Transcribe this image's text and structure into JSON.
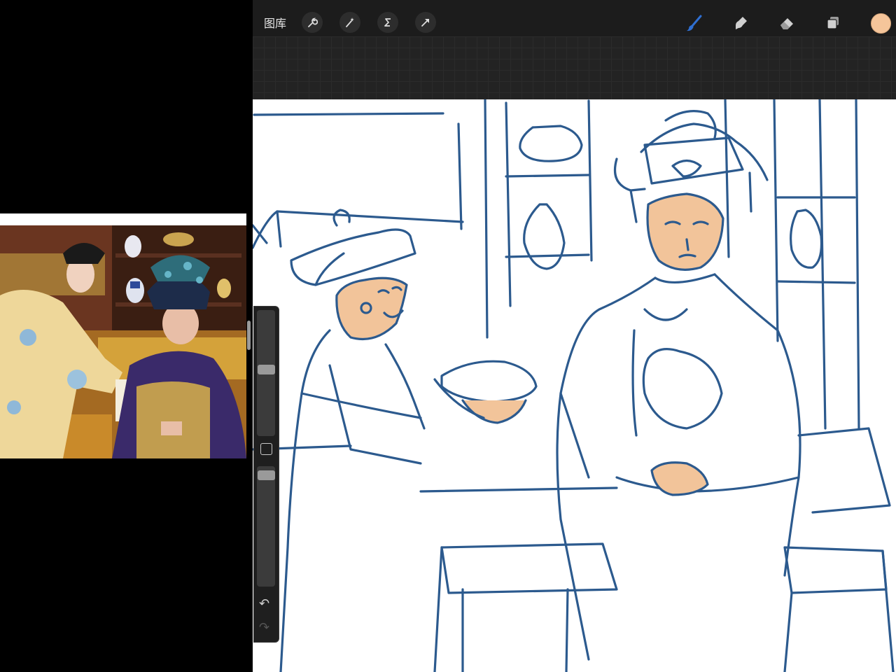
{
  "topbar": {
    "gallery_label": "图库",
    "tools_left": [
      "wrench-icon",
      "magic-wand-icon",
      "selection-s-icon",
      "transform-arrow-icon"
    ],
    "tools_right": [
      "brush-icon",
      "smudge-icon",
      "eraser-icon",
      "layers-icon"
    ],
    "active_tool": "brush-icon",
    "color_swatch": "#f5c59a",
    "brush_color": "#2f6fd1"
  },
  "sidebar": {
    "size_slider_level": 0.47,
    "opacity_slider_level": 0.04,
    "undo_icon": "↶",
    "redo_icon": "↷"
  },
  "colors": {
    "sketch_blue": "#2c5a8e",
    "skin": "#f2c49a",
    "toolbar_bg": "#1c1c1c"
  }
}
